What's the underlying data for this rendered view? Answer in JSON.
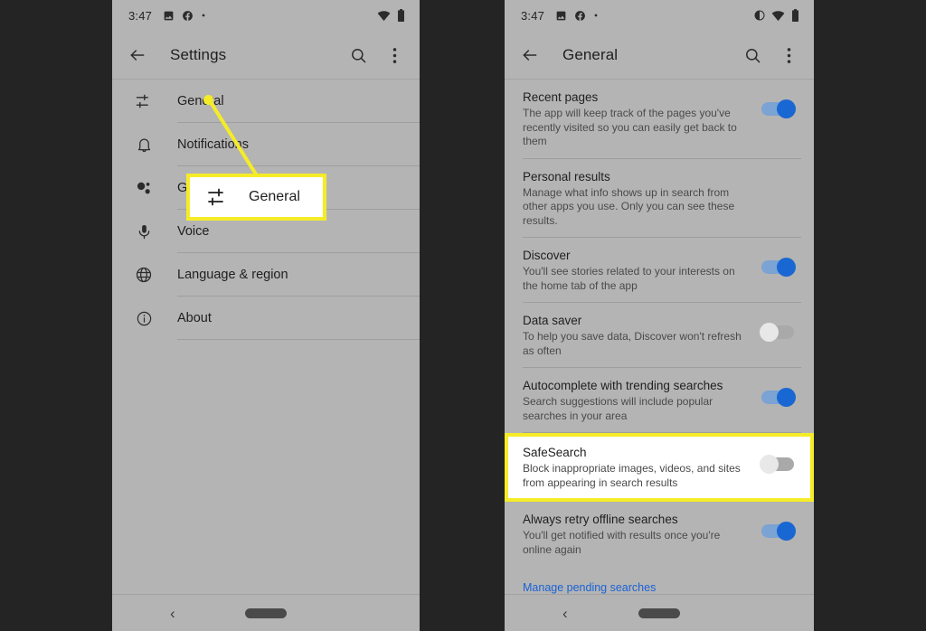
{
  "colors": {
    "page_background": "#242424",
    "phone_background": "#b4b4b4",
    "highlight_yellow": "#f5ec28",
    "toggle_on_blue": "#1967d2",
    "link_blue": "#1a62d6"
  },
  "left_phone": {
    "status_bar": {
      "time": "3:47",
      "left_icons": [
        "image-icon",
        "facebook-icon",
        "dot-icon"
      ],
      "right_icons": [
        "wifi-icon",
        "battery-icon"
      ]
    },
    "app_bar": {
      "back_icon": "arrow-left-icon",
      "title": "Settings",
      "search_icon": "search-icon",
      "overflow_icon": "more-vert-icon"
    },
    "nav_items": [
      {
        "icon": "tune-sliders-icon",
        "label": "General"
      },
      {
        "icon": "bell-icon",
        "label": "Notifications"
      },
      {
        "icon": "assistant-icon",
        "label": "Googl"
      },
      {
        "icon": "microphone-icon",
        "label": "Voice"
      },
      {
        "icon": "globe-icon",
        "label": "Language & region"
      },
      {
        "icon": "info-circle-icon",
        "label": "About"
      }
    ],
    "nav_bar": {
      "back_label": "‹",
      "home_pill": "home-pill-icon"
    }
  },
  "callout": {
    "icon": "tune-sliders-icon",
    "label": "General"
  },
  "right_phone": {
    "status_bar": {
      "time": "3:47",
      "left_icons": [
        "image-icon",
        "facebook-icon",
        "dot-icon"
      ],
      "right_icons": [
        "do-not-disturb-icon",
        "wifi-icon",
        "battery-icon"
      ]
    },
    "app_bar": {
      "back_icon": "arrow-left-icon",
      "title": "General",
      "search_icon": "search-icon",
      "overflow_icon": "more-vert-icon"
    },
    "settings": [
      {
        "title": "Recent pages",
        "description": "The app will keep track of the pages you've recently visited so you can easily get back to them",
        "toggle": "on",
        "highlighted": false
      },
      {
        "title": "Personal results",
        "description": "Manage what info shows up in search from other apps you use. Only you can see these results.",
        "toggle": "none",
        "highlighted": false
      },
      {
        "title": "Discover",
        "description": "You'll see stories related to your interests on the home tab of the app",
        "toggle": "on",
        "highlighted": false
      },
      {
        "title": "Data saver",
        "description": "To help you save data, Discover won't refresh as often",
        "toggle": "off",
        "highlighted": false
      },
      {
        "title": "Autocomplete with trending searches",
        "description": "Search suggestions will include popular searches in your area",
        "toggle": "on",
        "highlighted": false
      },
      {
        "title": "SafeSearch",
        "description": "Block inappropriate images, videos, and sites from appearing in search results",
        "toggle": "off",
        "highlighted": true
      },
      {
        "title": "Always retry offline searches",
        "description": "You'll get notified with results once you're online again",
        "toggle": "on",
        "highlighted": false
      }
    ],
    "link": "Manage pending searches",
    "nav_bar": {
      "back_label": "‹",
      "home_pill": "home-pill-icon"
    }
  }
}
